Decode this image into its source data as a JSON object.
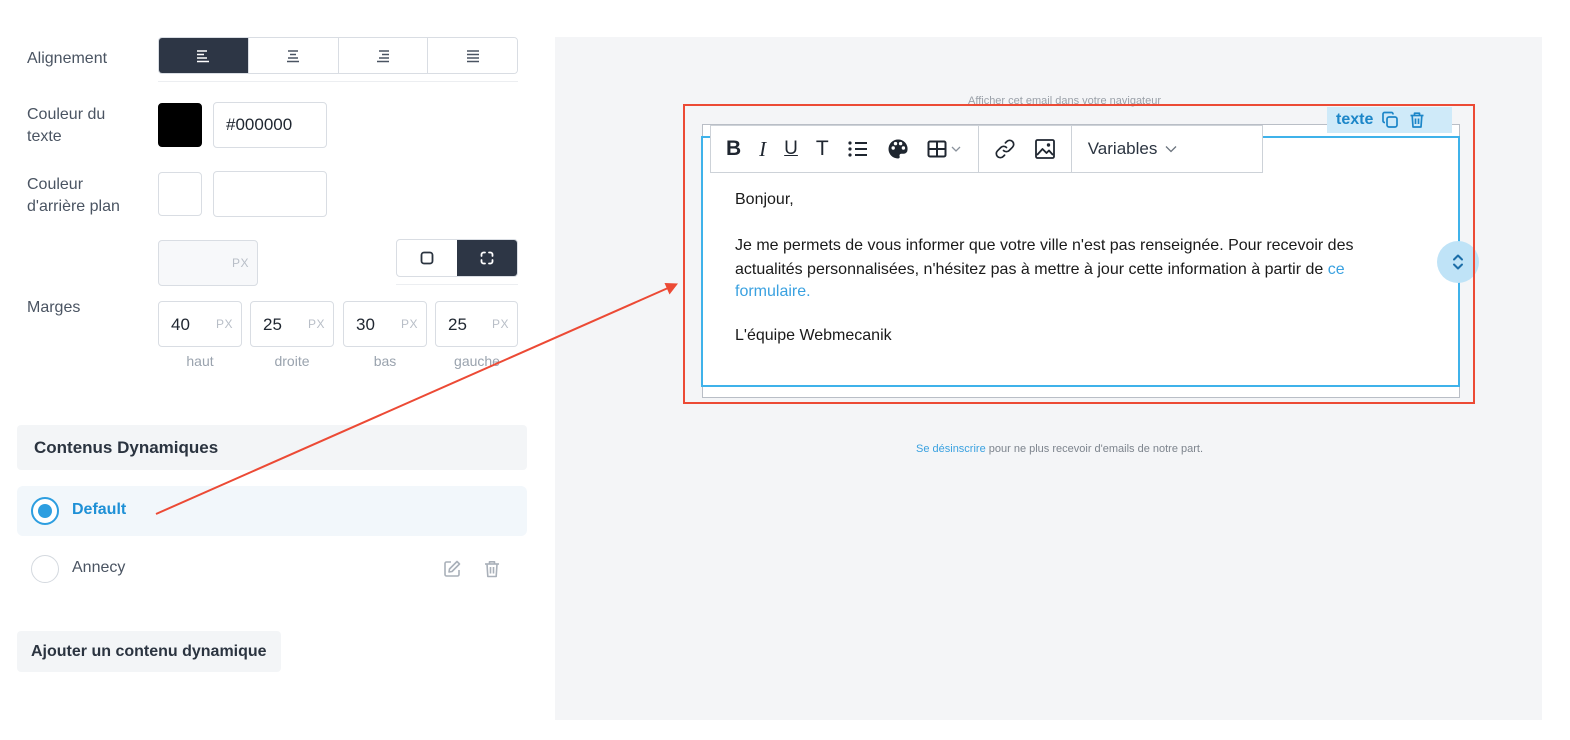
{
  "settings": {
    "alignment_label": "Alignement",
    "text_color_label_line1": "Couleur du",
    "text_color_label_line2": "texte",
    "text_color_value": "#000000",
    "text_color_swatch": "#000000",
    "bg_color_label_line1": "Couleur",
    "bg_color_label_line2": "d'arrière plan",
    "bg_color_value": "",
    "margins_label": "Marges",
    "px_unit": "PX",
    "margin_all_value": "",
    "margins": [
      {
        "value": "40",
        "label": "haut"
      },
      {
        "value": "25",
        "label": "droite"
      },
      {
        "value": "30",
        "label": "bas"
      },
      {
        "value": "25",
        "label": "gauche"
      }
    ]
  },
  "dynamic": {
    "section_title": "Contenus Dynamiques",
    "items": [
      {
        "label": "Default",
        "selected": true
      },
      {
        "label": "Annecy",
        "selected": false
      }
    ],
    "add_button": "Ajouter un contenu dynamique"
  },
  "preview": {
    "browser_link": "Afficher cet email dans votre navigateur",
    "block_tag": "texte",
    "toolbar": {
      "bold": "B",
      "italic": "I",
      "underline": "U",
      "text_size": "T",
      "variables": "Variables"
    },
    "email": {
      "greeting": "Bonjour,",
      "body_line1": "Je me permets de vous informer que votre ville n'est pas renseignée. Pour recevoir des",
      "body_line2": "actualités personnalisées, n'hésitez pas à mettre à jour cette information à partir de ",
      "link_part1": "ce",
      "link_part2": "formulaire.",
      "signature": "L'équipe Webmecanik"
    },
    "unsubscribe_link": "Se désinscrire",
    "unsubscribe_text": " pour ne plus recevoir d'emails de notre part."
  },
  "colors": {
    "accent": "#2d9ee0",
    "dark": "#2d3645",
    "highlight_red": "#ec4a35",
    "selection_blue": "#3fb2ea"
  }
}
